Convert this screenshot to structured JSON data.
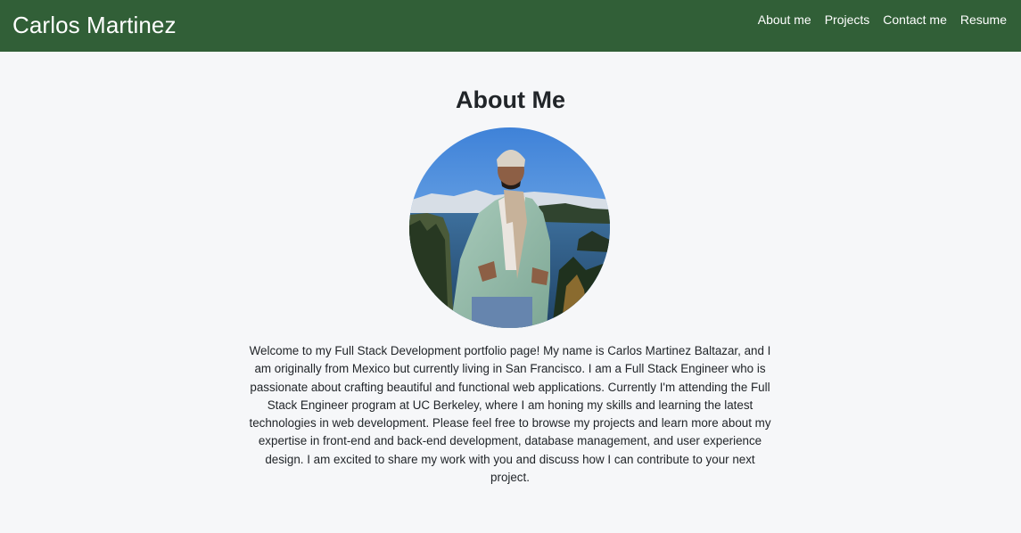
{
  "header": {
    "brand": "Carlos Martinez",
    "nav": [
      {
        "label": "About me"
      },
      {
        "label": "Projects"
      },
      {
        "label": "Contact me"
      },
      {
        "label": "Resume"
      }
    ]
  },
  "about": {
    "title": "About Me",
    "bio": "Welcome to my Full Stack Development portfolio page! My name is Carlos Martinez Baltazar, and I am originally from Mexico but currently living in San Francisco. I am a Full Stack Engineer who is passionate about crafting beautiful and functional web applications. Currently I'm attending the Full Stack Engineer program at UC Berkeley, where I am honing my skills and learning the latest technologies in web development. Please feel free to browse my projects and learn more about my expertise in front-end and back-end development, database management, and user experience design. I am excited to share my work with you and discuss how I can contribute to your next project."
  },
  "colors": {
    "navbar_background": "#315f37",
    "page_background": "#f6f7f9",
    "text": "#212529"
  }
}
